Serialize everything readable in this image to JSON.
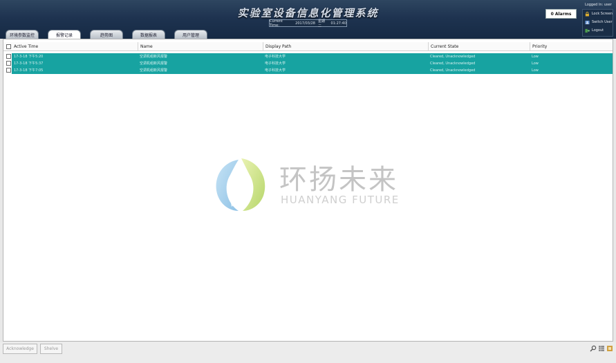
{
  "header": {
    "title": "实验室设备信息化管理系统",
    "time_label": "Current Time:",
    "date": "2017/03/28",
    "weekday": "星期二",
    "time": "01:27:40",
    "alarm_count": "0 Alarms",
    "logged_in": "Logged In: user",
    "actions": [
      {
        "label": "Lock Screen",
        "icon": "lock-icon"
      },
      {
        "label": "Switch User",
        "icon": "switch-user-icon"
      },
      {
        "label": "Logout",
        "icon": "logout-icon"
      }
    ]
  },
  "tabs": [
    "环境参数监控",
    "报警记录",
    "趋势图",
    "数据报表",
    "用户管理"
  ],
  "active_tab": "报警记录",
  "table": {
    "columns": [
      "Active Time",
      "Name",
      "Display Path",
      "Current State",
      "Priority"
    ],
    "rows": [
      [
        "17-3-18 下午5:20",
        "空调机组新风报警",
        "电子科技大学",
        "Cleared, Unacknowledged",
        "Low"
      ],
      [
        "17-3-18 下午5:37",
        "空调机组新风报警",
        "电子科技大学",
        "Cleared, Unacknowledged",
        "Low"
      ],
      [
        "17-3-18 下午7:05",
        "空调机组新风报警",
        "电子科技大学",
        "Cleared, Unacknowledged",
        "Low"
      ]
    ],
    "row_color": "#17a3a1"
  },
  "watermark": {
    "cn": "环扬未来",
    "en": "HUANYANG FUTURE"
  },
  "footer": {
    "acknowledge_label": "Acknowledge",
    "shelve_label": "Shelve",
    "icons": [
      "search-icon",
      "grid-icon",
      "export-icon"
    ]
  }
}
